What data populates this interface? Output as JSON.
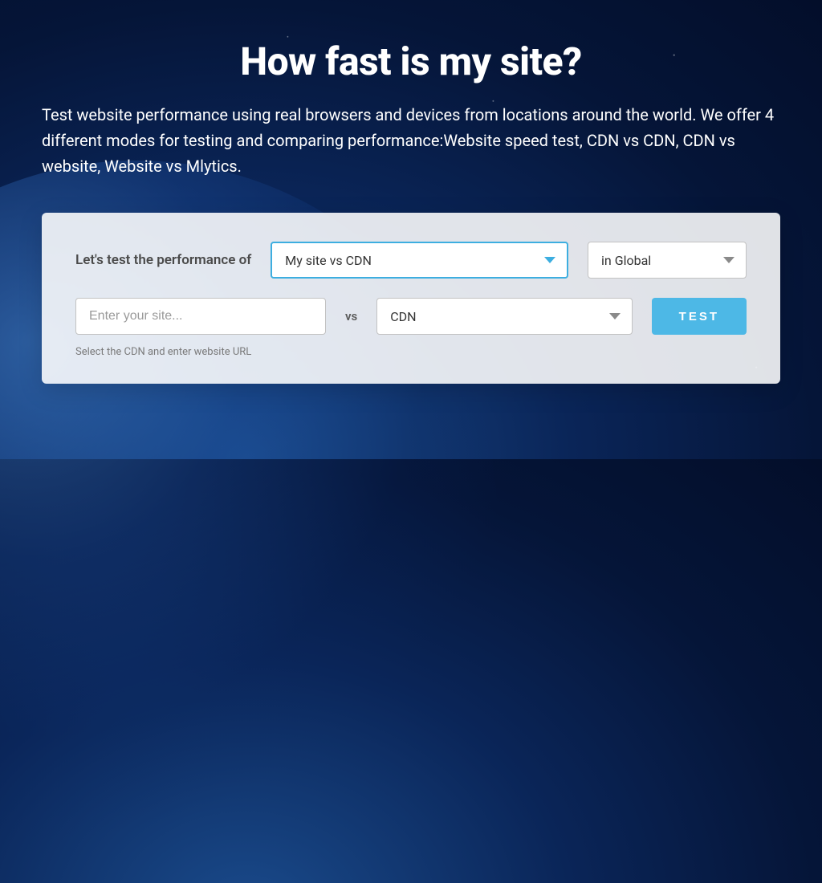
{
  "hero": {
    "title": "How fast is my site?",
    "subtitle": "Test website performance using real browsers and devices from locations around the world. We offer 4 different modes for testing and comparing performance:Website speed test, CDN vs CDN, CDN vs website, Website vs Mlytics."
  },
  "form": {
    "lead_label": "Let's test the performance of",
    "mode_select": {
      "value": "My site vs CDN"
    },
    "region_select": {
      "value": "in Global"
    },
    "site_input": {
      "placeholder": "Enter your site...",
      "value": ""
    },
    "vs_label": "vs",
    "cdn_select": {
      "value": "CDN"
    },
    "test_button": "TEST",
    "hint": "Select the CDN and enter website URL"
  },
  "colors": {
    "accent": "#3daee0",
    "button": "#4db8e6"
  }
}
